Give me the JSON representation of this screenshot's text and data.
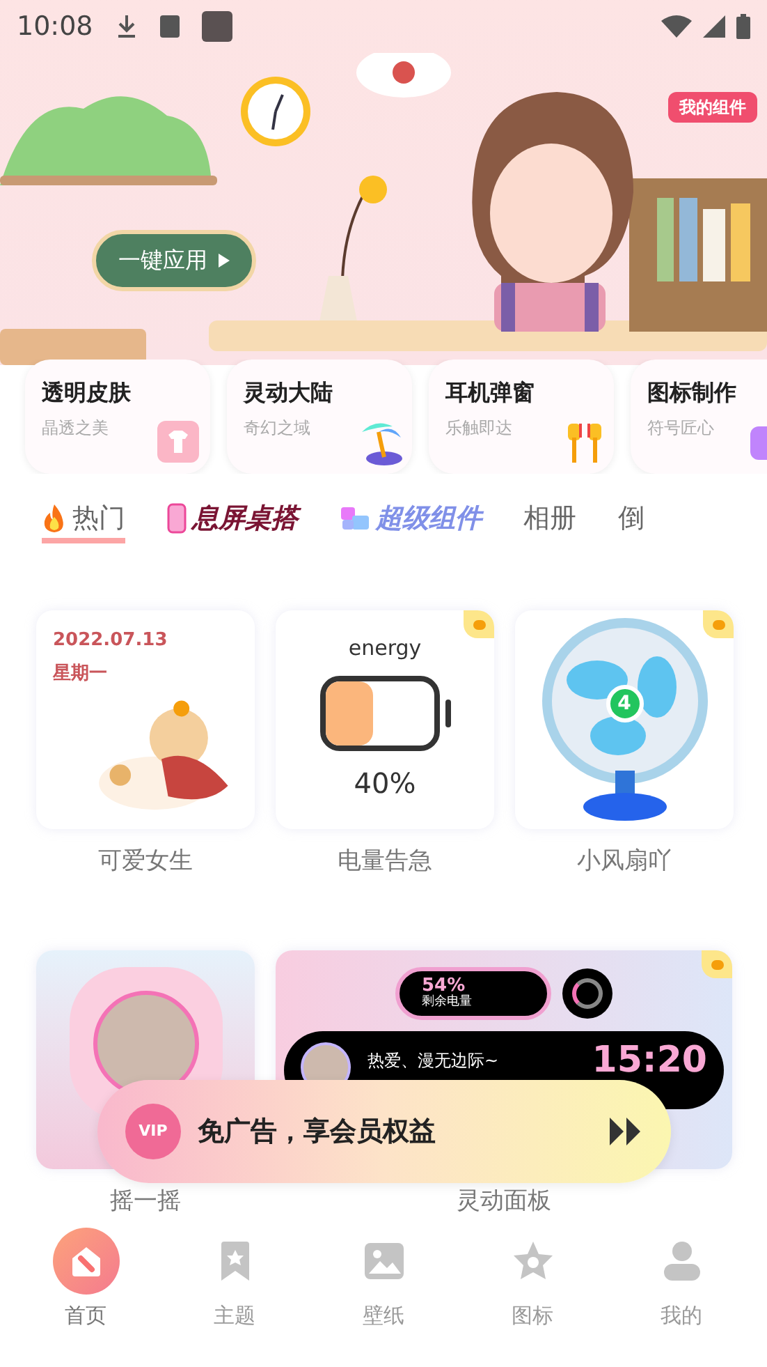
{
  "status_bar": {
    "time": "10:08"
  },
  "hero": {
    "apply_button": "一键应用",
    "widgets_button": "我的组件"
  },
  "categories": [
    {
      "title": "透明皮肤",
      "subtitle": "晶透之美",
      "kind": "shirt"
    },
    {
      "title": "灵动大陆",
      "subtitle": "奇幻之域",
      "kind": "palm"
    },
    {
      "title": "耳机弹窗",
      "subtitle": "乐触即达",
      "kind": "earphones"
    },
    {
      "title": "图标制作",
      "subtitle": "符号匠心",
      "kind": "icon"
    }
  ],
  "tabs": [
    {
      "label": "热门",
      "selected": true,
      "kind": "hot"
    },
    {
      "label": "息屏桌搭",
      "selected": false,
      "kind": "phone"
    },
    {
      "label": "超级组件",
      "selected": false,
      "kind": "puzzle"
    },
    {
      "label": "相册",
      "selected": false,
      "kind": "plain"
    },
    {
      "label": "倒",
      "selected": false,
      "kind": "plain"
    }
  ],
  "widgets": [
    {
      "label": "可爱女生",
      "kind": "calendar",
      "premium": false,
      "date": "2022.07.13",
      "weekday": "星期一"
    },
    {
      "label": "电量告急",
      "kind": "battery",
      "premium": true,
      "title": "energy",
      "reading": "40%",
      "level": 0.4
    },
    {
      "label": "小风扇吖",
      "kind": "fan",
      "premium": true,
      "badge": "4"
    },
    {
      "label": "摇一摇",
      "kind": "photo",
      "premium": false
    },
    {
      "label": "灵动面板",
      "kind": "island",
      "premium": true,
      "battery": "54%",
      "battery_caption": "剩余电量",
      "song": "热爱、漫无边际~",
      "clock": "15:20"
    }
  ],
  "vip_banner": {
    "badge": "VIP",
    "text": "免广告，享会员权益"
  },
  "nav": [
    {
      "label": "首页",
      "selected": true,
      "kind": "home"
    },
    {
      "label": "主题",
      "selected": false,
      "kind": "theme"
    },
    {
      "label": "壁纸",
      "selected": false,
      "kind": "wallpaper"
    },
    {
      "label": "图标",
      "selected": false,
      "kind": "icons"
    },
    {
      "label": "我的",
      "selected": false,
      "kind": "me"
    }
  ]
}
